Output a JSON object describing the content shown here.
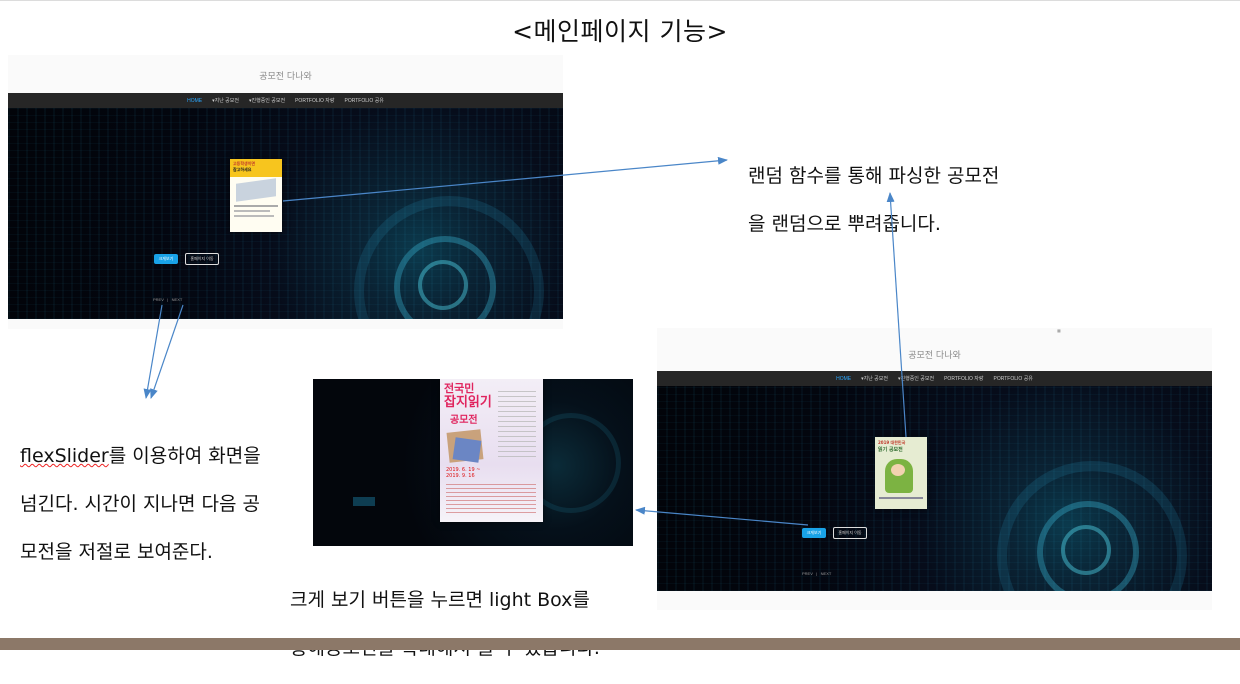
{
  "slide_title": "<메인페이지 기능>",
  "site": {
    "title": "공모전 다나와",
    "nav": [
      "HOME",
      "▾지난 공모전",
      "▾진행중인 공모전",
      "PORTFOLIO 자랑",
      "PORTFOLIO 공유"
    ],
    "buttons": {
      "primary": "크게보기",
      "secondary": "홈페이지 이동"
    },
    "pager": {
      "prev": "PREV",
      "separator": "|",
      "next": "NEXT"
    }
  },
  "posters": {
    "first": {
      "line1": "고등학생이면",
      "line2": "참고하세요"
    },
    "lightbox": {
      "line1": "전국민",
      "line2": "잡지읽기",
      "line3": "공모전",
      "dates": "2019. 6. 19 ~\n2019. 9. 16"
    },
    "second": {
      "line1": "2019 대한민국",
      "line2": "읽기 공모전"
    }
  },
  "notes": {
    "random_line1": "랜덤 함수를 통해 파싱한 공모전",
    "random_line2": "을 랜덤으로 뿌려줍니다.",
    "flex_prefix": "flexSlider",
    "flex_rest1": "를 이용하여 화면을",
    "flex_line2": "넘긴다. 시간이 지나면 다음 공",
    "flex_line3": "모전을 저절로 보여준다.",
    "lightbox_line1": "크게 보기 버튼을 누르면 light Box를",
    "lightbox_line2": "통해공모전을 확대해서 볼 수 있습니다."
  },
  "colors": {
    "arrow": "#4a86c8",
    "accent_button": "#19a3e8",
    "bottom_band": "#8c7868",
    "nav_bg": "#262626"
  }
}
